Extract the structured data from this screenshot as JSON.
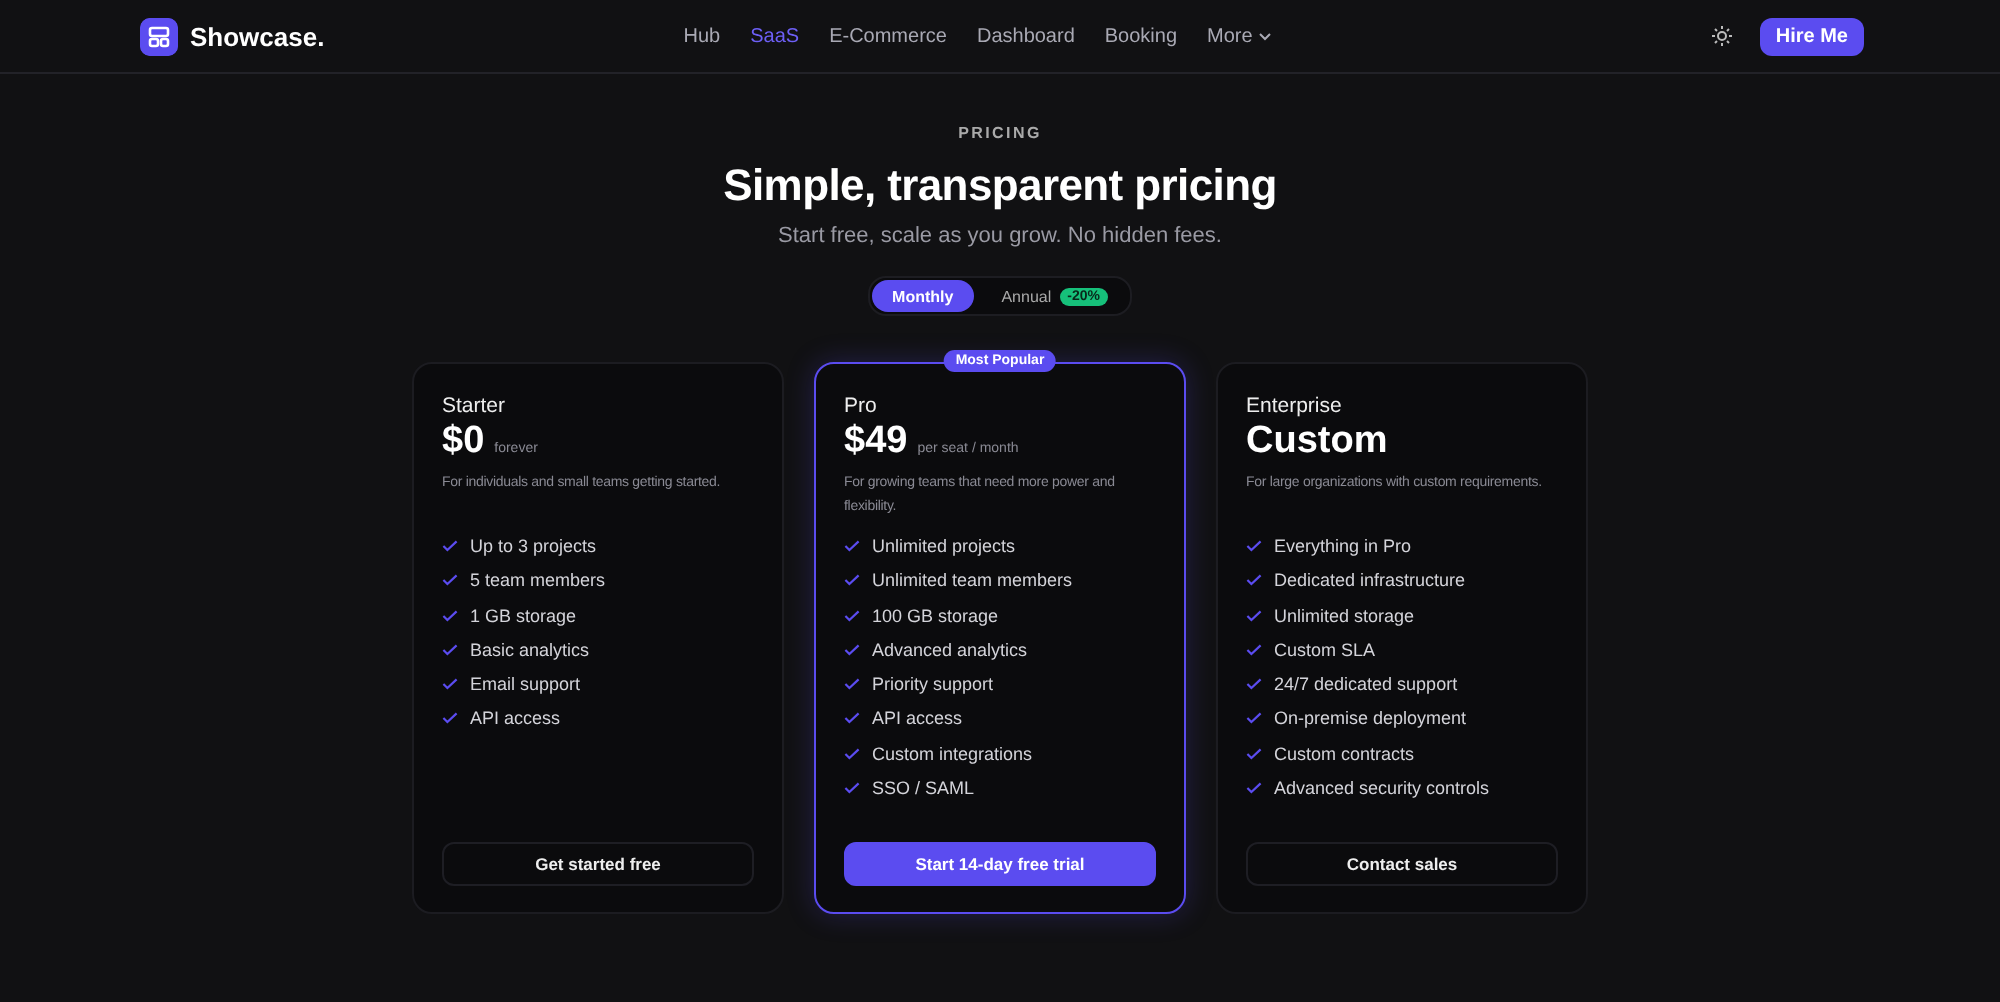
{
  "nav": {
    "brand": "Showcase.",
    "links": [
      {
        "label": "Hub",
        "selected": false
      },
      {
        "label": "SaaS",
        "selected": true
      },
      {
        "label": "E-Commerce",
        "selected": false
      },
      {
        "label": "Dashboard",
        "selected": false
      },
      {
        "label": "Booking",
        "selected": false
      }
    ],
    "more": "More",
    "cta": "Hire Me"
  },
  "header": {
    "eyebrow": "PRICING",
    "title": "Simple, transparent pricing",
    "subtitle": "Start free, scale as you grow. No hidden fees."
  },
  "billing": [
    {
      "label": "Monthly",
      "selected": true
    },
    {
      "label": "Annual",
      "selected": false,
      "badge": "-20%"
    }
  ],
  "plans": [
    {
      "name": "Starter",
      "price": "$0",
      "period": "forever",
      "description": "For individuals and small teams getting started.",
      "featured": false,
      "features": [
        "Up to 3 projects",
        "5 team members",
        "1 GB storage",
        "Basic analytics",
        "Email support",
        "API access"
      ],
      "button": "Get started free"
    },
    {
      "name": "Pro",
      "price": "$49",
      "period": "per seat / month",
      "description": "For growing teams that need more power and flexibility.",
      "featured": true,
      "badge": "Most Popular",
      "features": [
        "Unlimited projects",
        "Unlimited team members",
        "100 GB storage",
        "Advanced analytics",
        "Priority support",
        "API access",
        "Custom integrations",
        "SSO / SAML"
      ],
      "button": "Start 14-day free trial"
    },
    {
      "name": "Enterprise",
      "price": "Custom",
      "description": "For large organizations with custom requirements.",
      "featured": false,
      "features": [
        "Everything in Pro",
        "Dedicated infrastructure",
        "Unlimited storage",
        "Custom SLA",
        "24/7 dedicated support",
        "On-premise deployment",
        "Custom contracts",
        "Advanced security controls"
      ],
      "button": "Contact sales"
    }
  ]
}
